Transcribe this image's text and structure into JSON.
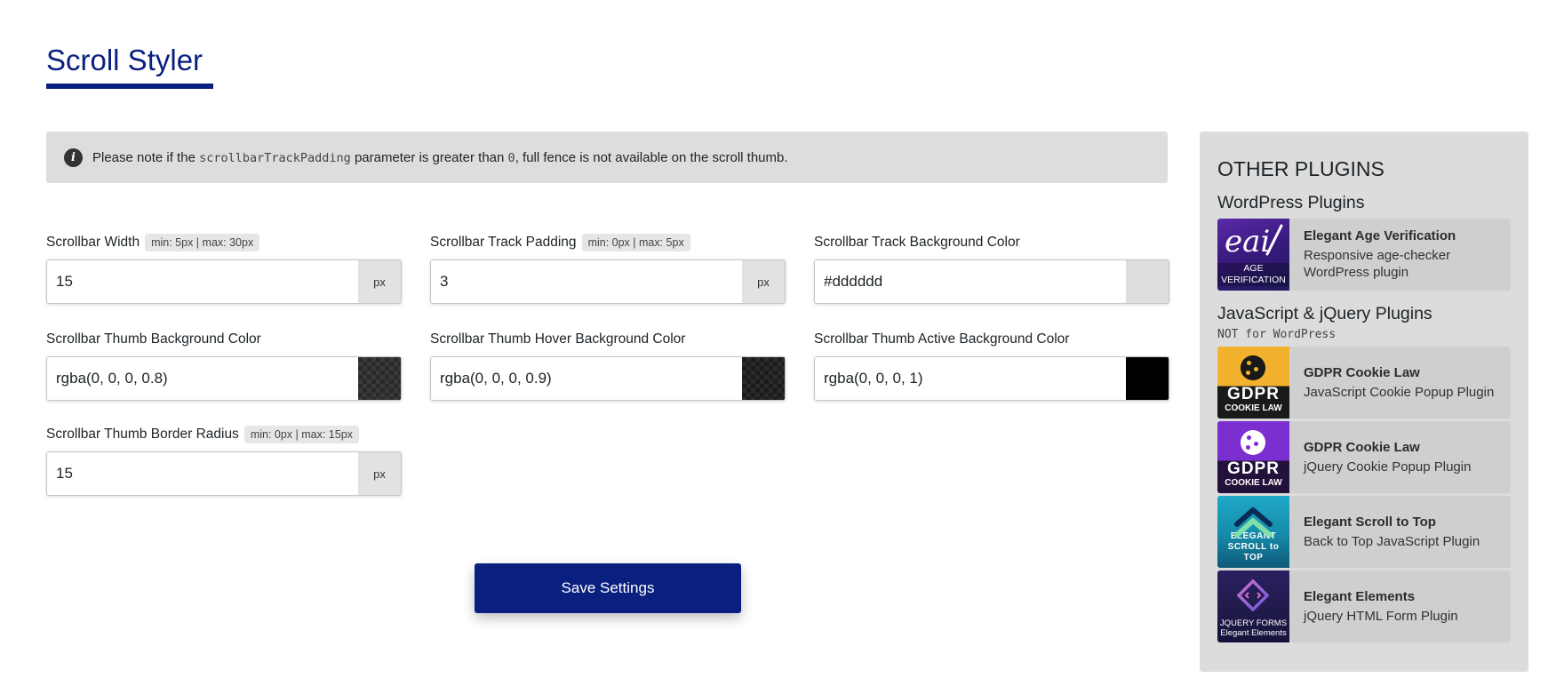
{
  "page": {
    "title": "Scroll Styler"
  },
  "notice": {
    "icon": "info-icon",
    "text_before": "Please note if the ",
    "code_param": "scrollbarTrackPadding",
    "text_middle": " parameter is greater than ",
    "code_value": "0",
    "text_after": ", full fence is not available on the scroll thumb."
  },
  "fields": {
    "scrollbar_width": {
      "label": "Scrollbar Width",
      "range": "min: 5px | max: 30px",
      "value": "15",
      "unit": "px"
    },
    "track_padding": {
      "label": "Scrollbar Track Padding",
      "range": "min: 0px | max: 5px",
      "value": "3",
      "unit": "px"
    },
    "track_bg": {
      "label": "Scrollbar Track Background Color",
      "value": "#dddddd",
      "swatch_color": "#dddddd"
    },
    "thumb_bg": {
      "label": "Scrollbar Thumb Background Color",
      "value": "rgba(0, 0, 0, 0.8)",
      "swatch_color": "rgba(0, 0, 0, 0.8)"
    },
    "thumb_hover_bg": {
      "label": "Scrollbar Thumb Hover Background Color",
      "value": "rgba(0, 0, 0, 0.9)",
      "swatch_color": "rgba(0, 0, 0, 0.9)"
    },
    "thumb_active_bg": {
      "label": "Scrollbar Thumb Active Background Color",
      "value": "rgba(0, 0, 0, 1)",
      "swatch_color": "rgba(0, 0, 0, 1)"
    },
    "thumb_radius": {
      "label": "Scrollbar Thumb Border Radius",
      "range": "min: 0px | max: 15px",
      "value": "15",
      "unit": "px"
    }
  },
  "actions": {
    "save_label": "Save Settings"
  },
  "sidebar": {
    "title": "OTHER PLUGINS",
    "wordpress": {
      "title": "WordPress Plugins",
      "items": [
        {
          "name": "Elegant Age Verification",
          "desc": "Responsive age-checker WordPress plugin",
          "thumb_logo": "eai",
          "thumb_caption_1": "AGE",
          "thumb_caption_2": "VERIFICATION"
        }
      ]
    },
    "js": {
      "title": "JavaScript & jQuery Plugins",
      "subtitle": "NOT for WordPress",
      "items": [
        {
          "name": "GDPR Cookie Law",
          "desc": "JavaScript Cookie Popup Plugin",
          "thumb_word": "GDPR",
          "thumb_sub": "COOKIE LAW"
        },
        {
          "name": "GDPR Cookie Law",
          "desc": "jQuery Cookie Popup Plugin",
          "thumb_word": "GDPR",
          "thumb_sub": "COOKIE LAW"
        },
        {
          "name": "Elegant Scroll to Top",
          "desc": "Back to Top JavaScript Plugin",
          "thumb_caption_1": "ELEGANT",
          "thumb_caption_2": "SCROLL to TOP"
        },
        {
          "name": "Elegant Elements",
          "desc": "jQuery HTML Form Plugin",
          "thumb_caption_1": "JQUERY FORMS",
          "thumb_caption_2": "Elegant Elements"
        }
      ]
    }
  },
  "colors": {
    "brand": "#0a2080",
    "notice_bg": "#dddddd",
    "sidebar_bg": "#dcdcdc"
  }
}
